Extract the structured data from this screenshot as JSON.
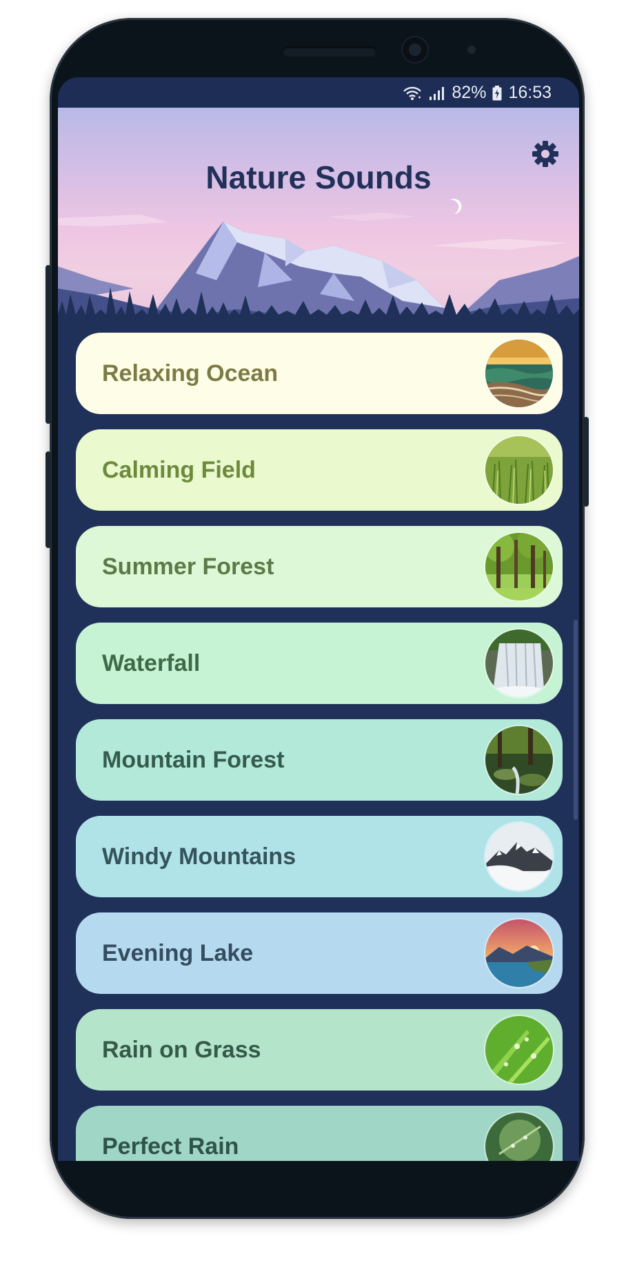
{
  "status_bar": {
    "battery": "82%",
    "time": "16:53",
    "icons": [
      "wifi-icon",
      "signal-icon",
      "battery-icon"
    ]
  },
  "header": {
    "title": "Nature Sounds",
    "settings_icon": "gear-icon"
  },
  "sounds": [
    {
      "label": "Relaxing Ocean",
      "bg": "#fefde8",
      "fg": "#7b7b44",
      "thumb": "ocean"
    },
    {
      "label": "Calming Field",
      "bg": "#eaf9ce",
      "fg": "#6d8a3c",
      "thumb": "field"
    },
    {
      "label": "Summer Forest",
      "bg": "#dcf8d6",
      "fg": "#5c7a47",
      "thumb": "forest"
    },
    {
      "label": "Waterfall",
      "bg": "#c6f3d3",
      "fg": "#3e6a49",
      "thumb": "waterfall"
    },
    {
      "label": "Mountain Forest",
      "bg": "#b3e9d9",
      "fg": "#355b4d",
      "thumb": "mountain-forest"
    },
    {
      "label": "Windy Mountains",
      "bg": "#b0e3e8",
      "fg": "#35535b",
      "thumb": "windy-mountains"
    },
    {
      "label": "Evening Lake",
      "bg": "#b5d9ee",
      "fg": "#334c5e",
      "thumb": "evening-lake"
    },
    {
      "label": "Rain on Grass",
      "bg": "#b4e5ca",
      "fg": "#355a48",
      "thumb": "rain-grass"
    },
    {
      "label": "Perfect Rain",
      "bg": "#9fd6c5",
      "fg": "#2f5348",
      "thumb": "perfect-rain"
    }
  ]
}
